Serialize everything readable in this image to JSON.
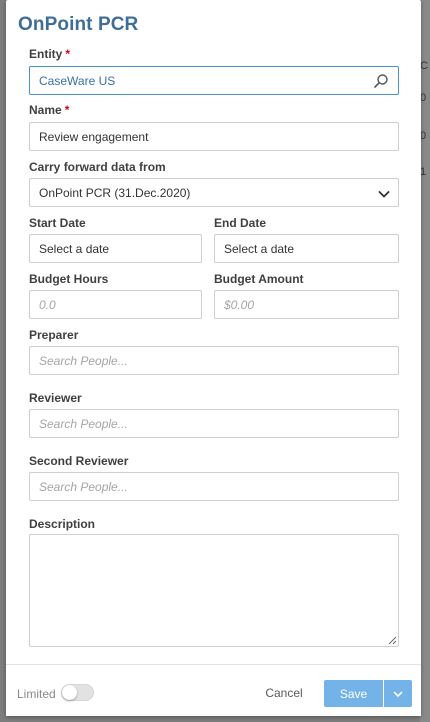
{
  "backdrop": {
    "fragments": [
      "C",
      "0",
      "0",
      "1"
    ]
  },
  "dialog": {
    "title": "OnPoint PCR"
  },
  "form": {
    "entity": {
      "label": "Entity",
      "required_mark": "*",
      "value": "CaseWare US",
      "icon": "search-icon"
    },
    "name": {
      "label": "Name",
      "required_mark": "*",
      "value": "Review engagement"
    },
    "carry_forward": {
      "label": "Carry forward data from",
      "value": "OnPoint PCR (31.Dec.2020)",
      "icon": "chevron-down-icon"
    },
    "start_date": {
      "label": "Start Date",
      "value": "Select a date"
    },
    "end_date": {
      "label": "End Date",
      "value": "Select a date"
    },
    "budget_hours": {
      "label": "Budget Hours",
      "placeholder": "0.0"
    },
    "budget_amount": {
      "label": "Budget Amount",
      "placeholder": "$0.00"
    },
    "preparer": {
      "label": "Preparer",
      "placeholder": "Search People..."
    },
    "reviewer": {
      "label": "Reviewer",
      "placeholder": "Search People..."
    },
    "second_reviewer": {
      "label": "Second Reviewer",
      "placeholder": "Search People..."
    },
    "description": {
      "label": "Description",
      "value": ""
    }
  },
  "footer": {
    "limited_label": "Limited",
    "limited_on": false,
    "cancel_label": "Cancel",
    "save_label": "Save",
    "accent_color": "#74b3e8"
  }
}
